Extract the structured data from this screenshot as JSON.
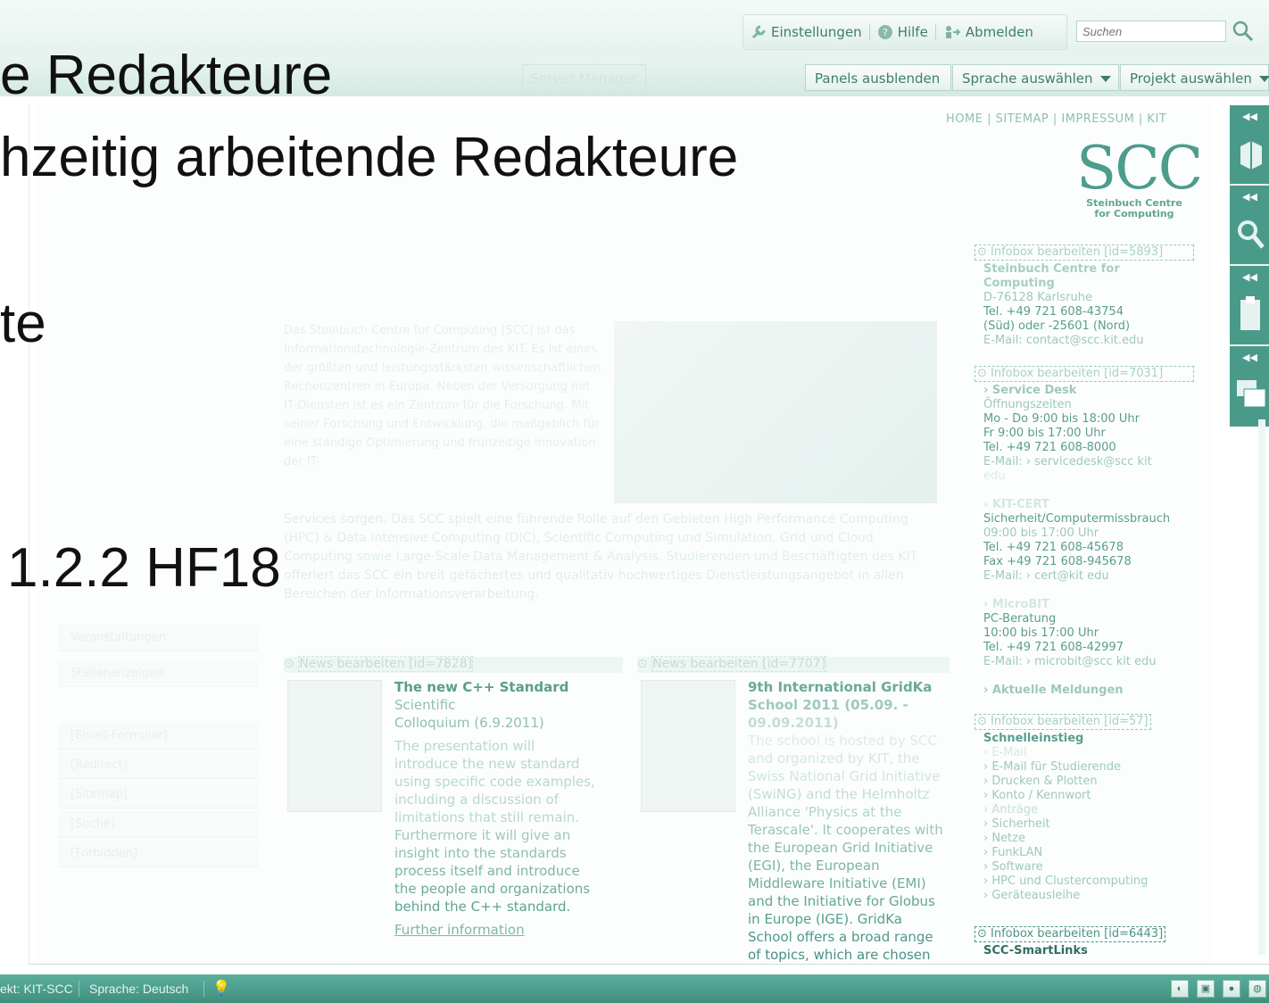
{
  "toolbar": {
    "settings_label": "Einstellungen",
    "help_label": "Hilfe",
    "logout_label": "Abmelden",
    "search_placeholder": "Suchen"
  },
  "second_bar": {
    "server_manager_label": "Server Manager",
    "panels_label": "Panels ausblenden",
    "language_label": "Sprache auswählen",
    "project_label": "Projekt auswählen"
  },
  "site": {
    "top_nav": "HOME | SITEMAP | IMPRESSUM | KIT",
    "logo_letters": "SCC",
    "logo_sub1": "Steinbuch Centre",
    "logo_sub2": "for Computing",
    "infobox1": {
      "header": "Infobox bearbeiten [id=5893]",
      "title": "Steinbuch Centre for Computing",
      "lines": [
        "D-76128 Karlsruhe",
        "Tel. +49 721 608-43754",
        "(Süd) oder -25601 (Nord)",
        "E-Mail: contact@scc.kit.edu"
      ]
    },
    "infobox2": {
      "header": "Infobox bearbeiten [id=7031]",
      "service_title": "› Service Desk",
      "service_lines": [
        "Öffnungszeiten",
        "Mo - Do 9:00 bis 18:00 Uhr",
        "Fr 9:00 bis 17:00 Uhr",
        "Tel. +49 721 608-8000",
        "E-Mail: › servicedesk@scc kit",
        "edu"
      ],
      "cert_title": "› KIT-CERT",
      "cert_lines": [
        "Sicherheit/Computermissbrauch",
        "09:00 bis 17:00 Uhr",
        "Tel. +49 721 608-45678",
        "Fax +49 721 608-945678",
        "E-Mail: › cert@kit edu"
      ],
      "micro_title": "› MicroBIT",
      "micro_lines": [
        "PC-Beratung",
        "10:00 bis 17:00 Uhr",
        "Tel. +49 721 608-42997",
        "E-Mail: › microbit@scc kit edu"
      ],
      "news_link": "› Aktuelle Meldungen"
    },
    "infobox3": {
      "header": "Infobox bearbeiten [id=57]",
      "title": "Schnelleinstieg",
      "links": [
        "› E-Mail",
        "› E-Mail für Studierende",
        "› Drucken & Plotten",
        "› Konto / Kennwort",
        "› Anträge",
        "› Sicherheit",
        "› Netze",
        "› FunkLAN",
        "› Software",
        "› HPC und Clustercomputing",
        "› Geräteausleihe"
      ]
    },
    "infobox4": {
      "header": "Infobox bearbeiten [id=6443]",
      "title": "SCC-SmartLinks"
    },
    "body_text": "Das Steinbuch Centre for Computing (SCC) ist das Informationstechnologie-Zentrum des KIT. Es ist eines der größten und leistungsstärksten wissenschaftlichen Rechenzentren in Europa. Neben der Versorgung mit IT-Diensten ist es ein Zentrum für die Forschung. Mit seiner Forschung und Entwicklung, die maßgeblich für eine ständige Optimierung und frühzeitige Innovation der IT-",
    "body_text2": "Services sorgen. Das SCC spielt eine führende Rolle auf den Gebieten High Performance Computing (HPC) & Data Intensive Computing (DIC), Scientific Computing und Simulation, Grid und Cloud Computing sowie Large-Scale Data Management & Analysis. Studierenden und Beschäftigten des KIT offeriert das SCC ein breit gefächertes und qualitativ hochwertiges Dienstleistungsangebot in allen Bereichen der Informationsverarbeitung.",
    "news1": {
      "header": "News bearbeiten [id=7828]",
      "title": "The new C++ Standard",
      "subtitle1": "Scientific",
      "subtitle2": "Colloquium (6.9.2011)",
      "text": [
        "The presentation will",
        "introduce the new standard",
        "using specific code examples,",
        "including a discussion of",
        "limitations that still remain.",
        "Furthermore it will give an",
        "insight into the standards",
        "process itself and introduce",
        "the people and organizations",
        "behind the C++ standard."
      ],
      "link": "Further information"
    },
    "news2": {
      "header": "News bearbeiten [id=7707]",
      "title": [
        "9th International GridKa",
        "School 2011 (05.09. -",
        "09.09.2011)"
      ],
      "text": [
        "The school is hosted by SCC",
        "and organized by KIT, the",
        "Swiss National Grid Initiative",
        "(SwiNG) and the Helmholtz",
        "Alliance 'Physics at the",
        "Terascale'. It cooperates with",
        "the European Grid Initiative",
        "(EGI), the European",
        "Middleware Initiative (EMI)",
        "and the Initiative for Globus",
        "in Europe (IGE). GridKa",
        "School offers a broad range",
        "of topics, which are chosen"
      ]
    },
    "sidebar": [
      "[Email-Formular]",
      "[Redirect]",
      "[Sitemap]",
      "[Suche]",
      "[Forbidden]"
    ],
    "sidebar_extra": [
      "Veranstaltungen",
      "Stellenanzeigen"
    ]
  },
  "slide": {
    "line1": "e Redakteure",
    "line2": "hzeitig arbeitende Redakteure",
    "line3": "te",
    "line4": "1.2.2 HF18"
  },
  "statusbar": {
    "project": "ekt: KIT-SCC",
    "language": "Sprache: Deutsch"
  },
  "colors": {
    "accent": "#4a9a8a",
    "status_bar": "#4f9f8d",
    "slide_text": "#111111"
  }
}
